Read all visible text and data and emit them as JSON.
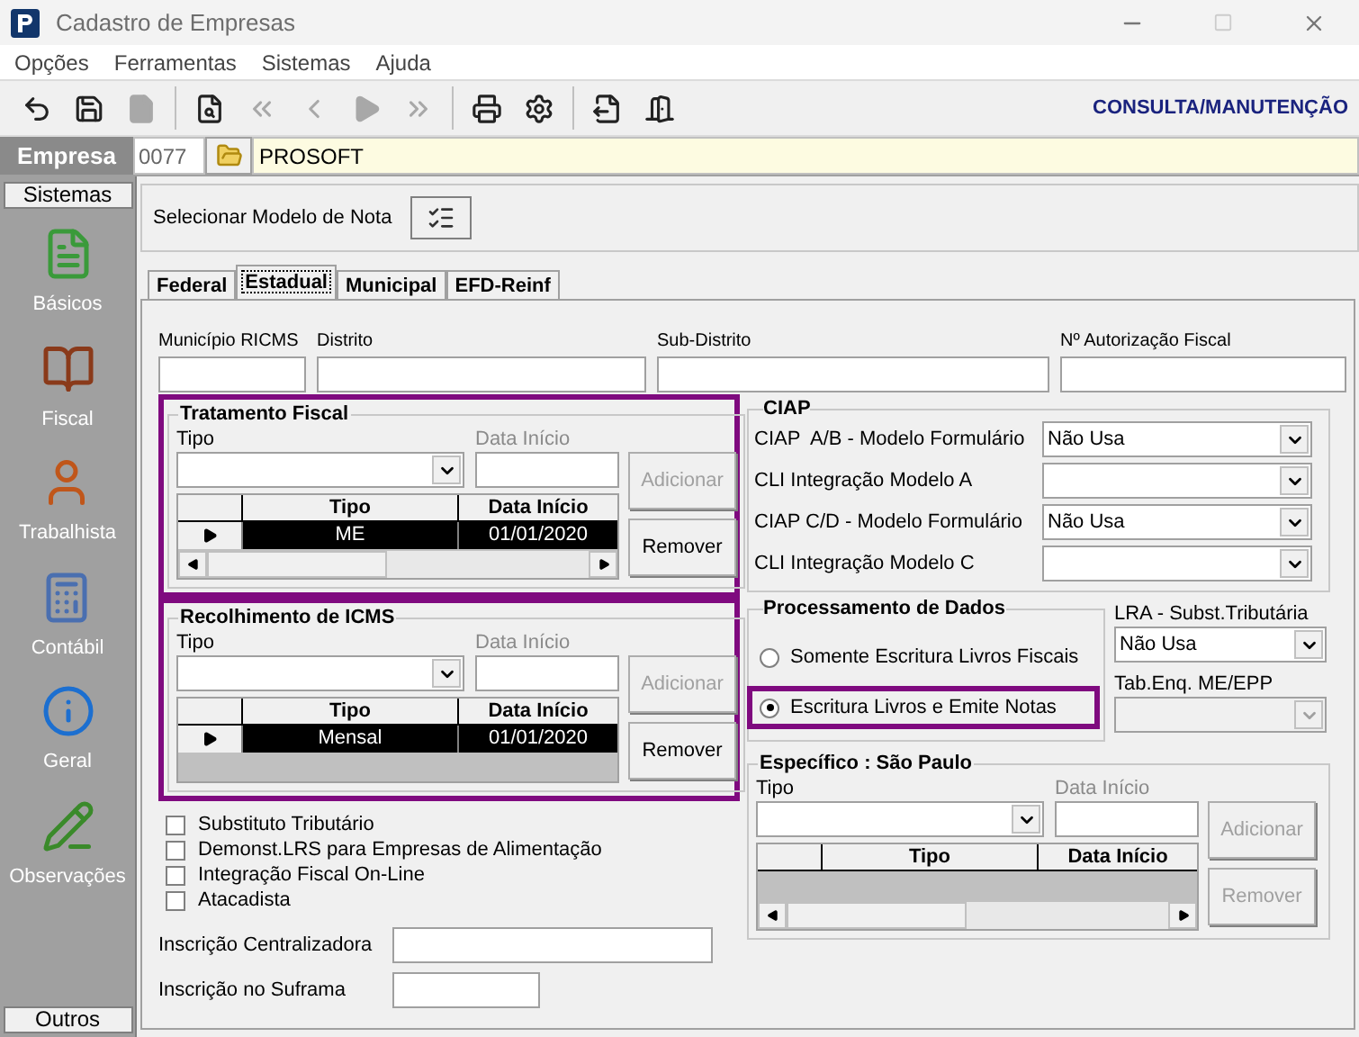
{
  "window": {
    "title": "Cadastro de Empresas"
  },
  "menu": [
    "Opções",
    "Ferramentas",
    "Sistemas",
    "Ajuda"
  ],
  "toolbar": {
    "buttons": [
      {
        "kind": "undo",
        "disabled": false
      },
      {
        "kind": "save",
        "disabled": false
      },
      {
        "kind": "document",
        "disabled": true
      },
      {
        "kind": "preview",
        "disabled": false
      },
      {
        "kind": "first",
        "disabled": true
      },
      {
        "kind": "prev",
        "disabled": true
      },
      {
        "kind": "next",
        "disabled": true
      },
      {
        "kind": "last",
        "disabled": true
      },
      {
        "kind": "print",
        "disabled": false
      },
      {
        "kind": "tools",
        "disabled": false
      },
      {
        "kind": "export",
        "disabled": false
      },
      {
        "kind": "exit",
        "disabled": false
      }
    ],
    "mode": "CONSULTA/MANUTENÇÃO"
  },
  "empresa": {
    "label": "Empresa",
    "code": "0077",
    "name": "PROSOFT"
  },
  "sidebar": {
    "header": "Sistemas",
    "items": [
      {
        "label": "Básicos",
        "kind": "basicos"
      },
      {
        "label": "Fiscal",
        "kind": "fiscal"
      },
      {
        "label": "Trabalhista",
        "kind": "trabalhista"
      },
      {
        "label": "Contábil",
        "kind": "contabil"
      },
      {
        "label": "Geral",
        "kind": "geral"
      },
      {
        "label": "Observações",
        "kind": "observacoes"
      }
    ],
    "footer": "Outros"
  },
  "model_note": {
    "label": "Selecionar Modelo de Nota"
  },
  "tabs": [
    {
      "label": "Federal",
      "selected": false
    },
    {
      "label": "Estadual",
      "selected": true
    },
    {
      "label": "Municipal",
      "selected": false
    },
    {
      "label": "EFD-Reinf",
      "selected": false
    }
  ],
  "fields_row": [
    {
      "label": "Município RICMS"
    },
    {
      "label": "Distrito"
    },
    {
      "label": "Sub-Distrito"
    },
    {
      "label": "Nº Autorização Fiscal"
    }
  ],
  "tratamento": {
    "title": "Tratamento Fiscal",
    "highlighted": true,
    "type_label": "Tipo",
    "date_label": "Data Início",
    "add": "Adicionar",
    "remove": "Remover",
    "remove_disabled": false,
    "columns": [
      "Tipo",
      "Data Início"
    ],
    "rows": [
      {
        "cells": [
          "ME",
          "01/01/2020"
        ],
        "selected": true
      }
    ],
    "scrollbar": true
  },
  "recolhimento": {
    "title": "Recolhimento de ICMS",
    "highlighted": true,
    "type_label": "Tipo",
    "date_label": "Data Início",
    "add": "Adicionar",
    "remove": "Remover",
    "remove_disabled": false,
    "columns": [
      "Tipo",
      "Data Início"
    ],
    "rows": [
      {
        "cells": [
          "Mensal",
          "01/01/2020"
        ],
        "selected": true
      }
    ],
    "scrollbar": false
  },
  "checkboxes": [
    {
      "label": "Substituto Tributário",
      "checked": false
    },
    {
      "label": "Demonst.LRS para Empresas de Alimentação",
      "checked": false
    },
    {
      "label": "Integração Fiscal On-Line",
      "checked": false
    },
    {
      "label": "Atacadista",
      "checked": false
    }
  ],
  "inscricoes": [
    {
      "label": "Inscrição Centralizadora"
    },
    {
      "label": "Inscrição no Suframa"
    }
  ],
  "ciap": {
    "title": "CIAP",
    "rows": [
      {
        "label": "CIAP  A/B - Modelo Formulário",
        "value": "Não Usa"
      },
      {
        "label": "CLI Integração Modelo A"
      },
      {
        "label": "CIAP C/D - Modelo Formulário",
        "value": "Não Usa"
      },
      {
        "label": "CLI Integração Modelo C"
      }
    ]
  },
  "processamento": {
    "title": "Processamento de Dados",
    "options": [
      {
        "label": "Somente Escritura Livros Fiscais",
        "selected": false,
        "highlighted": false
      },
      {
        "label": "Escritura Livros e Emite Notas",
        "selected": true,
        "highlighted": true
      }
    ]
  },
  "lra": {
    "label": "LRA - Subst.Tributária",
    "value": "Não Usa",
    "disabled": false
  },
  "tab_enq": {
    "label": "Tab.Enq. ME/EPP",
    "disabled": true
  },
  "especifico": {
    "title": "Específico : São Paulo",
    "highlighted": false,
    "type_label": "Tipo",
    "date_label": "Data Início",
    "add": "Adicionar",
    "remove": "Remover",
    "remove_disabled": true,
    "columns": [
      "Tipo",
      "Data Início"
    ],
    "scrollbar": true
  }
}
